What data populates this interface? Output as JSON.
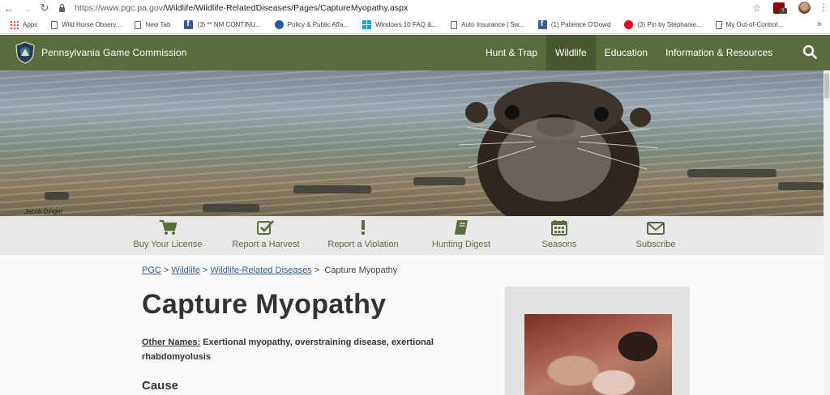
{
  "browser": {
    "url_prefix": "https://www.pgc.pa.gov",
    "url_path": "/Wildlife/Wildlife-RelatedDiseases/Pages/CaptureMyopathy.aspx",
    "extension_badge": "1",
    "bookmarks": [
      {
        "label": "Apps",
        "icon": "apps-icon"
      },
      {
        "label": "Wild Horse Observ...",
        "icon": "page-icon"
      },
      {
        "label": "New Tab",
        "icon": "page-icon"
      },
      {
        "label": "(3) ** NM CONTINU...",
        "icon": "facebook-icon"
      },
      {
        "label": "Policy & Public Affa...",
        "icon": "ae-icon"
      },
      {
        "label": "Windows 10 FAQ &...",
        "icon": "windows-icon"
      },
      {
        "label": "Auto Insurance | Sw...",
        "icon": "page-icon"
      },
      {
        "label": "(1) Patience O'Dowd",
        "icon": "facebook-icon"
      },
      {
        "label": "(3) Pin by Stéphanie...",
        "icon": "pinterest-icon"
      },
      {
        "label": "My Out-of-Control...",
        "icon": "page-icon"
      }
    ],
    "more": "»"
  },
  "header": {
    "site_title": "Pennsylvania Game Commission",
    "nav": [
      "Hunt & Trap",
      "Wildlife",
      "Education",
      "Information & Resources"
    ],
    "active_nav": "Wildlife"
  },
  "hero": {
    "photo_credit": "Jacob Dingel"
  },
  "quick_links": [
    {
      "label": "Buy Your License",
      "icon": "shopping-cart-icon"
    },
    {
      "label": "Report a Harvest",
      "icon": "checkbox-icon"
    },
    {
      "label": "Report a Violation",
      "icon": "exclamation-icon"
    },
    {
      "label": "Hunting Digest",
      "icon": "book-icon"
    },
    {
      "label": "Seasons",
      "icon": "calendar-icon"
    },
    {
      "label": "Subscribe",
      "icon": "envelope-icon"
    }
  ],
  "breadcrumb": {
    "items": [
      "PGC",
      "Wildlife",
      "Wildlife-Related Diseases"
    ],
    "separator": ">",
    "current": "Capture Myopathy"
  },
  "page": {
    "title": "Capture Myopathy",
    "other_names_label": "Other Names:",
    "other_names_text": "Exertional myopathy, overstraining disease, exertional rhabdomyolusis",
    "section_heading": "Cause"
  },
  "colors": {
    "header_bg": "#5a6b3e",
    "nav_active_bg": "#4a5832",
    "link": "#3a5a8c",
    "quick_link_bg": "#e8e8e8"
  }
}
